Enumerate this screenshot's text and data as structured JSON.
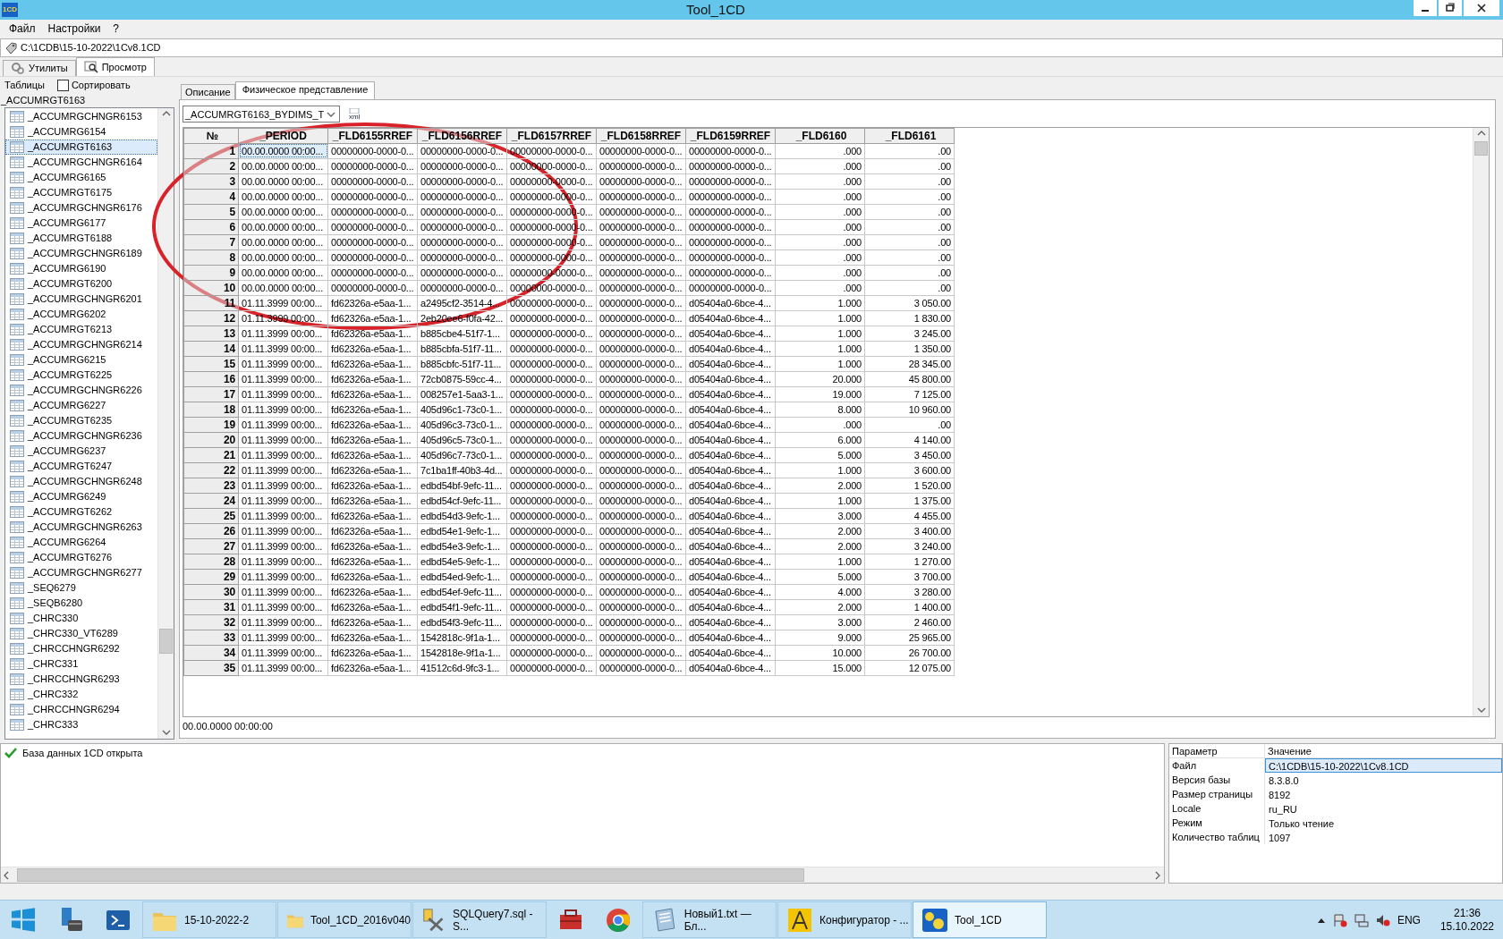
{
  "window": {
    "title": "Tool_1CD",
    "app_icon": "1CD"
  },
  "menu": [
    "Файл",
    "Настройки",
    "?"
  ],
  "path": "C:\\1CDB\\15-10-2022\\1Cv8.1CD",
  "tabs": [
    {
      "label": "Утилиты",
      "kind": "utilities",
      "selected": false
    },
    {
      "label": "Просмотр",
      "kind": "view",
      "selected": true
    }
  ],
  "tables_panel": {
    "label": "Таблицы",
    "sort": {
      "label": "Сортировать",
      "checked": false
    },
    "current": "_ACCUMRGT6163",
    "items": [
      {
        "name": "_ACCUMRGCHNGR6153",
        "selected": false
      },
      {
        "name": "_ACCUMRG6154",
        "selected": false
      },
      {
        "name": "_ACCUMRGT6163",
        "selected": true
      },
      {
        "name": "_ACCUMRGCHNGR6164",
        "selected": false
      },
      {
        "name": "_ACCUMRG6165",
        "selected": false
      },
      {
        "name": "_ACCUMRGT6175",
        "selected": false
      },
      {
        "name": "_ACCUMRGCHNGR6176",
        "selected": false
      },
      {
        "name": "_ACCUMRG6177",
        "selected": false
      },
      {
        "name": "_ACCUMRGT6188",
        "selected": false
      },
      {
        "name": "_ACCUMRGCHNGR6189",
        "selected": false
      },
      {
        "name": "_ACCUMRG6190",
        "selected": false
      },
      {
        "name": "_ACCUMRGT6200",
        "selected": false
      },
      {
        "name": "_ACCUMRGCHNGR6201",
        "selected": false
      },
      {
        "name": "_ACCUMRG6202",
        "selected": false
      },
      {
        "name": "_ACCUMRGT6213",
        "selected": false
      },
      {
        "name": "_ACCUMRGCHNGR6214",
        "selected": false
      },
      {
        "name": "_ACCUMRG6215",
        "selected": false
      },
      {
        "name": "_ACCUMRGT6225",
        "selected": false
      },
      {
        "name": "_ACCUMRGCHNGR6226",
        "selected": false
      },
      {
        "name": "_ACCUMRG6227",
        "selected": false
      },
      {
        "name": "_ACCUMRGT6235",
        "selected": false
      },
      {
        "name": "_ACCUMRGCHNGR6236",
        "selected": false
      },
      {
        "name": "_ACCUMRG6237",
        "selected": false
      },
      {
        "name": "_ACCUMRGT6247",
        "selected": false
      },
      {
        "name": "_ACCUMRGCHNGR6248",
        "selected": false
      },
      {
        "name": "_ACCUMRG6249",
        "selected": false
      },
      {
        "name": "_ACCUMRGT6262",
        "selected": false
      },
      {
        "name": "_ACCUMRGCHNGR6263",
        "selected": false
      },
      {
        "name": "_ACCUMRG6264",
        "selected": false
      },
      {
        "name": "_ACCUMRGT6276",
        "selected": false
      },
      {
        "name": "_ACCUMRGCHNGR6277",
        "selected": false
      },
      {
        "name": "_SEQ6279",
        "selected": false
      },
      {
        "name": "_SEQB6280",
        "selected": false
      },
      {
        "name": "_CHRC330",
        "selected": false
      },
      {
        "name": "_CHRC330_VT6289",
        "selected": false
      },
      {
        "name": "_CHRCCHNGR6292",
        "selected": false
      },
      {
        "name": "_CHRC331",
        "selected": false
      },
      {
        "name": "_CHRCCHNGR6293",
        "selected": false
      },
      {
        "name": "_CHRC332",
        "selected": false
      },
      {
        "name": "_CHRCCHNGR6294",
        "selected": false
      },
      {
        "name": "_CHRC333",
        "selected": false
      }
    ]
  },
  "view": {
    "tabs": [
      {
        "label": "Описание",
        "selected": false
      },
      {
        "label": "Физическое представление",
        "selected": true
      }
    ],
    "index_select": "_ACCUMRGT6163_BYDIMS_T",
    "export_label": "xml",
    "table": {
      "columns": [
        {
          "label": "№",
          "numeric": true
        },
        {
          "label": "_PERIOD",
          "numeric": false
        },
        {
          "label": "_FLD6155RREF",
          "numeric": false
        },
        {
          "label": "_FLD6156RREF",
          "numeric": false
        },
        {
          "label": "_FLD6157RREF",
          "numeric": false
        },
        {
          "label": "_FLD6158RREF",
          "numeric": false
        },
        {
          "label": "_FLD6159RREF",
          "numeric": false
        },
        {
          "label": "_FLD6160",
          "numeric": true
        },
        {
          "label": "_FLD6161",
          "numeric": true
        }
      ],
      "rows": [
        {
          "selected": true,
          "cells": [
            "1",
            "00.00.0000 00:00...",
            "00000000-0000-0...",
            "00000000-0000-0...",
            "00000000-0000-0...",
            "00000000-0000-0...",
            "00000000-0000-0...",
            ".000",
            ".00"
          ]
        },
        {
          "selected": false,
          "cells": [
            "2",
            "00.00.0000 00:00...",
            "00000000-0000-0...",
            "00000000-0000-0...",
            "00000000-0000-0...",
            "00000000-0000-0...",
            "00000000-0000-0...",
            ".000",
            ".00"
          ]
        },
        {
          "selected": false,
          "cells": [
            "3",
            "00.00.0000 00:00...",
            "00000000-0000-0...",
            "00000000-0000-0...",
            "00000000-0000-0...",
            "00000000-0000-0...",
            "00000000-0000-0...",
            ".000",
            ".00"
          ]
        },
        {
          "selected": false,
          "cells": [
            "4",
            "00.00.0000 00:00...",
            "00000000-0000-0...",
            "00000000-0000-0...",
            "00000000-0000-0...",
            "00000000-0000-0...",
            "00000000-0000-0...",
            ".000",
            ".00"
          ]
        },
        {
          "selected": false,
          "cells": [
            "5",
            "00.00.0000 00:00...",
            "00000000-0000-0...",
            "00000000-0000-0...",
            "00000000-0000-0...",
            "00000000-0000-0...",
            "00000000-0000-0...",
            ".000",
            ".00"
          ]
        },
        {
          "selected": false,
          "cells": [
            "6",
            "00.00.0000 00:00...",
            "00000000-0000-0...",
            "00000000-0000-0...",
            "00000000-0000-0...",
            "00000000-0000-0...",
            "00000000-0000-0...",
            ".000",
            ".00"
          ]
        },
        {
          "selected": false,
          "cells": [
            "7",
            "00.00.0000 00:00...",
            "00000000-0000-0...",
            "00000000-0000-0...",
            "00000000-0000-0...",
            "00000000-0000-0...",
            "00000000-0000-0...",
            ".000",
            ".00"
          ]
        },
        {
          "selected": false,
          "cells": [
            "8",
            "00.00.0000 00:00...",
            "00000000-0000-0...",
            "00000000-0000-0...",
            "00000000-0000-0...",
            "00000000-0000-0...",
            "00000000-0000-0...",
            ".000",
            ".00"
          ]
        },
        {
          "selected": false,
          "cells": [
            "9",
            "00.00.0000 00:00...",
            "00000000-0000-0...",
            "00000000-0000-0...",
            "00000000-0000-0...",
            "00000000-0000-0...",
            "00000000-0000-0...",
            ".000",
            ".00"
          ]
        },
        {
          "selected": false,
          "cells": [
            "10",
            "00.00.0000 00:00...",
            "00000000-0000-0...",
            "00000000-0000-0...",
            "00000000-0000-0...",
            "00000000-0000-0...",
            "00000000-0000-0...",
            ".000",
            ".00"
          ]
        },
        {
          "selected": false,
          "cells": [
            "11",
            "01.11.3999 00:00...",
            "fd62326a-e5aa-1...",
            "a2495cf2-3514-4...",
            "00000000-0000-0...",
            "00000000-0000-0...",
            "d05404a0-6bce-4...",
            "1.000",
            "3 050.00"
          ]
        },
        {
          "selected": false,
          "cells": [
            "12",
            "01.11.3999 00:00...",
            "fd62326a-e5aa-1...",
            "2eb20ee6-f0fa-42...",
            "00000000-0000-0...",
            "00000000-0000-0...",
            "d05404a0-6bce-4...",
            "1.000",
            "1 830.00"
          ]
        },
        {
          "selected": false,
          "cells": [
            "13",
            "01.11.3999 00:00...",
            "fd62326a-e5aa-1...",
            "b885cbe4-51f7-1...",
            "00000000-0000-0...",
            "00000000-0000-0...",
            "d05404a0-6bce-4...",
            "1.000",
            "3 245.00"
          ]
        },
        {
          "selected": false,
          "cells": [
            "14",
            "01.11.3999 00:00...",
            "fd62326a-e5aa-1...",
            "b885cbfa-51f7-11...",
            "00000000-0000-0...",
            "00000000-0000-0...",
            "d05404a0-6bce-4...",
            "1.000",
            "1 350.00"
          ]
        },
        {
          "selected": false,
          "cells": [
            "15",
            "01.11.3999 00:00...",
            "fd62326a-e5aa-1...",
            "b885cbfc-51f7-11...",
            "00000000-0000-0...",
            "00000000-0000-0...",
            "d05404a0-6bce-4...",
            "1.000",
            "28 345.00"
          ]
        },
        {
          "selected": false,
          "cells": [
            "16",
            "01.11.3999 00:00...",
            "fd62326a-e5aa-1...",
            "72cb0875-59cc-4...",
            "00000000-0000-0...",
            "00000000-0000-0...",
            "d05404a0-6bce-4...",
            "20.000",
            "45 800.00"
          ]
        },
        {
          "selected": false,
          "cells": [
            "17",
            "01.11.3999 00:00...",
            "fd62326a-e5aa-1...",
            "008257e1-5aa3-1...",
            "00000000-0000-0...",
            "00000000-0000-0...",
            "d05404a0-6bce-4...",
            "19.000",
            "7 125.00"
          ]
        },
        {
          "selected": false,
          "cells": [
            "18",
            "01.11.3999 00:00...",
            "fd62326a-e5aa-1...",
            "405d96c1-73c0-1...",
            "00000000-0000-0...",
            "00000000-0000-0...",
            "d05404a0-6bce-4...",
            "8.000",
            "10 960.00"
          ]
        },
        {
          "selected": false,
          "cells": [
            "19",
            "01.11.3999 00:00...",
            "fd62326a-e5aa-1...",
            "405d96c3-73c0-1...",
            "00000000-0000-0...",
            "00000000-0000-0...",
            "d05404a0-6bce-4...",
            ".000",
            ".00"
          ]
        },
        {
          "selected": false,
          "cells": [
            "20",
            "01.11.3999 00:00...",
            "fd62326a-e5aa-1...",
            "405d96c5-73c0-1...",
            "00000000-0000-0...",
            "00000000-0000-0...",
            "d05404a0-6bce-4...",
            "6.000",
            "4 140.00"
          ]
        },
        {
          "selected": false,
          "cells": [
            "21",
            "01.11.3999 00:00...",
            "fd62326a-e5aa-1...",
            "405d96c7-73c0-1...",
            "00000000-0000-0...",
            "00000000-0000-0...",
            "d05404a0-6bce-4...",
            "5.000",
            "3 450.00"
          ]
        },
        {
          "selected": false,
          "cells": [
            "22",
            "01.11.3999 00:00...",
            "fd62326a-e5aa-1...",
            "7c1ba1ff-40b3-4d...",
            "00000000-0000-0...",
            "00000000-0000-0...",
            "d05404a0-6bce-4...",
            "1.000",
            "3 600.00"
          ]
        },
        {
          "selected": false,
          "cells": [
            "23",
            "01.11.3999 00:00...",
            "fd62326a-e5aa-1...",
            "edbd54bf-9efc-11...",
            "00000000-0000-0...",
            "00000000-0000-0...",
            "d05404a0-6bce-4...",
            "2.000",
            "1 520.00"
          ]
        },
        {
          "selected": false,
          "cells": [
            "24",
            "01.11.3999 00:00...",
            "fd62326a-e5aa-1...",
            "edbd54cf-9efc-11...",
            "00000000-0000-0...",
            "00000000-0000-0...",
            "d05404a0-6bce-4...",
            "1.000",
            "1 375.00"
          ]
        },
        {
          "selected": false,
          "cells": [
            "25",
            "01.11.3999 00:00...",
            "fd62326a-e5aa-1...",
            "edbd54d3-9efc-1...",
            "00000000-0000-0...",
            "00000000-0000-0...",
            "d05404a0-6bce-4...",
            "3.000",
            "4 455.00"
          ]
        },
        {
          "selected": false,
          "cells": [
            "26",
            "01.11.3999 00:00...",
            "fd62326a-e5aa-1...",
            "edbd54e1-9efc-1...",
            "00000000-0000-0...",
            "00000000-0000-0...",
            "d05404a0-6bce-4...",
            "2.000",
            "3 400.00"
          ]
        },
        {
          "selected": false,
          "cells": [
            "27",
            "01.11.3999 00:00...",
            "fd62326a-e5aa-1...",
            "edbd54e3-9efc-1...",
            "00000000-0000-0...",
            "00000000-0000-0...",
            "d05404a0-6bce-4...",
            "2.000",
            "3 240.00"
          ]
        },
        {
          "selected": false,
          "cells": [
            "28",
            "01.11.3999 00:00...",
            "fd62326a-e5aa-1...",
            "edbd54e5-9efc-1...",
            "00000000-0000-0...",
            "00000000-0000-0...",
            "d05404a0-6bce-4...",
            "1.000",
            "1 270.00"
          ]
        },
        {
          "selected": false,
          "cells": [
            "29",
            "01.11.3999 00:00...",
            "fd62326a-e5aa-1...",
            "edbd54ed-9efc-1...",
            "00000000-0000-0...",
            "00000000-0000-0...",
            "d05404a0-6bce-4...",
            "5.000",
            "3 700.00"
          ]
        },
        {
          "selected": false,
          "cells": [
            "30",
            "01.11.3999 00:00...",
            "fd62326a-e5aa-1...",
            "edbd54ef-9efc-11...",
            "00000000-0000-0...",
            "00000000-0000-0...",
            "d05404a0-6bce-4...",
            "4.000",
            "3 280.00"
          ]
        },
        {
          "selected": false,
          "cells": [
            "31",
            "01.11.3999 00:00...",
            "fd62326a-e5aa-1...",
            "edbd54f1-9efc-11...",
            "00000000-0000-0...",
            "00000000-0000-0...",
            "d05404a0-6bce-4...",
            "2.000",
            "1 400.00"
          ]
        },
        {
          "selected": false,
          "cells": [
            "32",
            "01.11.3999 00:00...",
            "fd62326a-e5aa-1...",
            "edbd54f3-9efc-11...",
            "00000000-0000-0...",
            "00000000-0000-0...",
            "d05404a0-6bce-4...",
            "3.000",
            "2 460.00"
          ]
        },
        {
          "selected": false,
          "cells": [
            "33",
            "01.11.3999 00:00...",
            "fd62326a-e5aa-1...",
            "1542818c-9f1a-1...",
            "00000000-0000-0...",
            "00000000-0000-0...",
            "d05404a0-6bce-4...",
            "9.000",
            "25 965.00"
          ]
        },
        {
          "selected": false,
          "cells": [
            "34",
            "01.11.3999 00:00...",
            "fd62326a-e5aa-1...",
            "1542818e-9f1a-1...",
            "00000000-0000-0...",
            "00000000-0000-0...",
            "d05404a0-6bce-4...",
            "10.000",
            "26 700.00"
          ]
        },
        {
          "selected": false,
          "cells": [
            "35",
            "01.11.3999 00:00...",
            "fd62326a-e5aa-1...",
            "41512c6d-9fc3-1...",
            "00000000-0000-0...",
            "00000000-0000-0...",
            "d05404a0-6bce-4...",
            "15.000",
            "12 075.00"
          ]
        }
      ]
    },
    "cell_value": "00.00.0000 00:00:00"
  },
  "log": [
    {
      "kind": "success",
      "text": "База данных 1CD открыта"
    }
  ],
  "properties": {
    "columns": [
      "Параметр",
      "Значение"
    ],
    "rows": [
      {
        "name": "Файл",
        "value": "C:\\1CDB\\15-10-2022\\1Cv8.1CD",
        "selected": true
      },
      {
        "name": "Версия базы",
        "value": "8.3.8.0",
        "selected": false
      },
      {
        "name": "Размер страницы",
        "value": "8192",
        "selected": false
      },
      {
        "name": "Locale",
        "value": "ru_RU",
        "selected": false
      },
      {
        "name": "Режим",
        "value": "Только чтение",
        "selected": false
      },
      {
        "name": "Количество таблиц",
        "value": "1097",
        "selected": false
      }
    ]
  },
  "annotations": [
    {
      "kind": "ellipse"
    }
  ],
  "taskbar": {
    "items": [
      {
        "kind": "start",
        "selected": false
      },
      {
        "kind": "server",
        "selected": false
      },
      {
        "kind": "powershell",
        "selected": false
      },
      {
        "kind": "folder",
        "label": "15-10-2022-2",
        "selected": false
      },
      {
        "kind": "folder",
        "label": "Tool_1CD_2016v040",
        "selected": false
      },
      {
        "kind": "sql",
        "label": "SQLQuery7.sql - S...",
        "selected": false
      },
      {
        "kind": "toolbox",
        "selected": false
      },
      {
        "kind": "chrome",
        "selected": false
      },
      {
        "kind": "notepad",
        "label": "Новый1.txt — Бл...",
        "selected": false
      },
      {
        "kind": "configurator",
        "label": "Конфигуратор - ...",
        "selected": false
      },
      {
        "kind": "app",
        "label": "Tool_1CD",
        "selected": true
      }
    ],
    "tray": {
      "language": "ENG",
      "time": "21:36",
      "date": "15.10.2022"
    }
  }
}
